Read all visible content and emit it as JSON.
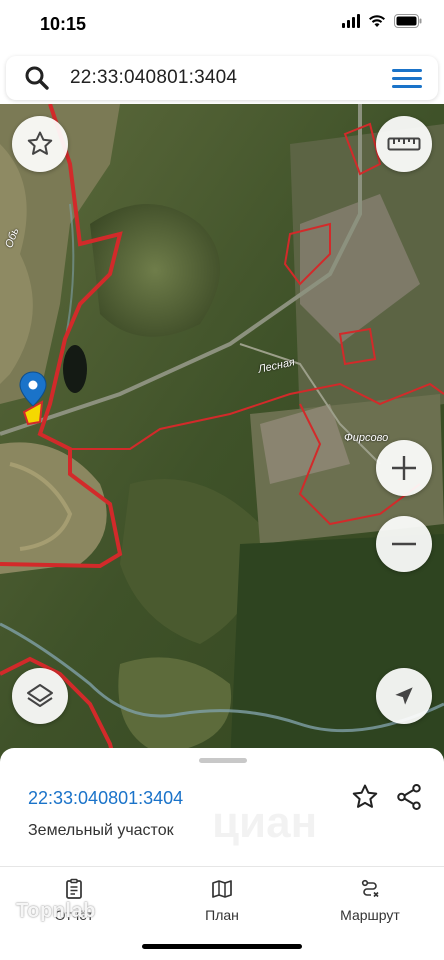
{
  "status_bar": {
    "time": "10:15"
  },
  "search": {
    "value": "22:33:040801:3404"
  },
  "map": {
    "labels": {
      "road": "Лесная",
      "village": "Фирсово",
      "river": "Обь"
    }
  },
  "parcel": {
    "number": "22:33:040801:3404",
    "type": "Земельный участок"
  },
  "tabs": [
    {
      "label": "Отчёт",
      "icon": "report-icon"
    },
    {
      "label": "План",
      "icon": "map-plan-icon"
    },
    {
      "label": "Маршрут",
      "icon": "route-icon"
    }
  ],
  "branding": {
    "watermark": "циан",
    "brand": "Topnlab"
  },
  "colors": {
    "accent": "#1a73c9",
    "boundary": "#d22a2a",
    "pin": "#1a73c9",
    "parcel_fill": "#f5d800"
  }
}
